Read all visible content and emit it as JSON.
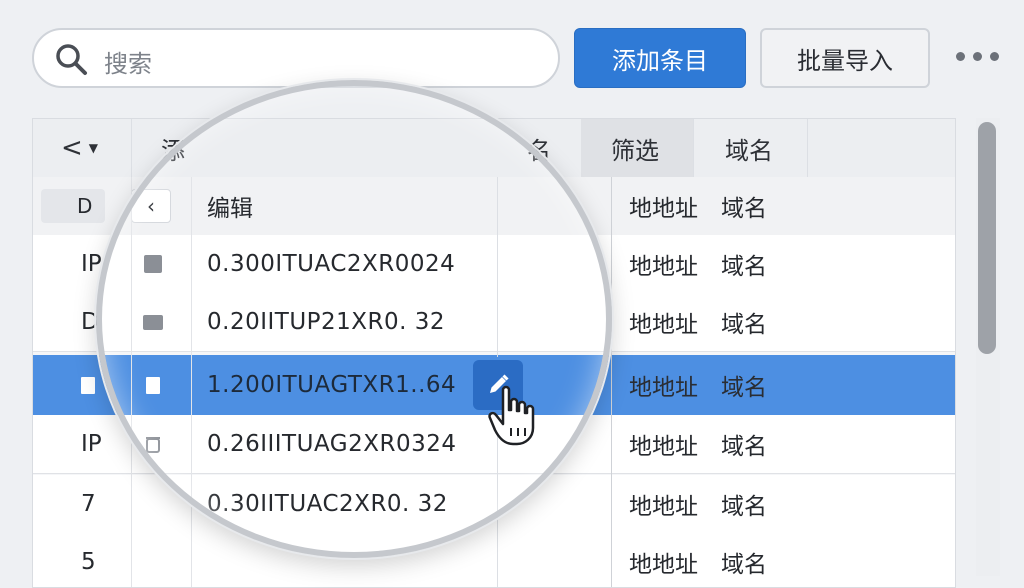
{
  "toolbar": {
    "search_placeholder": "搜索",
    "add_button": "添加条目",
    "import_button": "批量导入",
    "more_icon": "more-horizontal-icon"
  },
  "table": {
    "header_row1": {
      "nav": "<",
      "col_a": "添",
      "col_b": "名",
      "filter": "筛选",
      "domain": "域名"
    },
    "header_row2": {
      "id": "D",
      "name": "编辑",
      "address": "地地址",
      "domain": "域名"
    },
    "rows": [
      {
        "id": "IP",
        "icon": "square-icon",
        "name": "0.300ITUAC2XR0024",
        "address": "地地址",
        "domain": "域名"
      },
      {
        "id": "D",
        "icon": "folder-icon",
        "name": "0.20IITUP21XR0. 32",
        "address": "地地址",
        "domain": "域名"
      },
      {
        "id": "",
        "icon": "document-icon",
        "name": "1.200ITUAGTXR1..64",
        "address": "地地址",
        "domain": "域名",
        "selected": true
      },
      {
        "id": "IP",
        "icon": "trash-icon",
        "name": "0.26IIITUAG2XR0324",
        "address": "地地址",
        "domain": "域名"
      },
      {
        "id": "7",
        "icon": "",
        "name": "0.30IITUAC2XR0. 32",
        "address": "地地址",
        "domain": "域名"
      },
      {
        "id": "5",
        "icon": "",
        "name": "",
        "address": "地地址",
        "domain": "域名"
      }
    ]
  },
  "colors": {
    "primary": "#2f7ad6",
    "selection": "#4d8fe2",
    "edit_button": "#2b6cc4"
  }
}
